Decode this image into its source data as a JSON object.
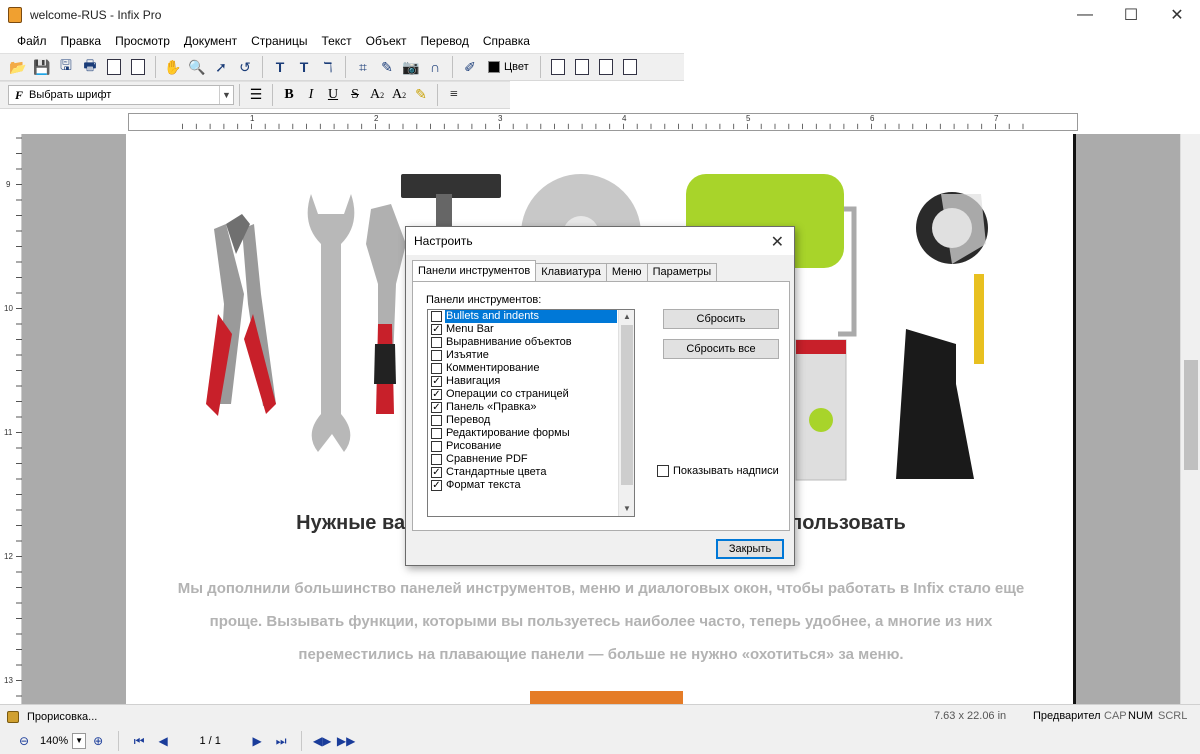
{
  "window": {
    "title": "welcome-RUS - Infix Pro",
    "minimize": "—",
    "maximize": "☐",
    "close": "✕"
  },
  "menu": [
    "Файл",
    "Правка",
    "Просмотр",
    "Документ",
    "Страницы",
    "Текст",
    "Объект",
    "Перевод",
    "Справка"
  ],
  "toolbar1": {
    "color_label": "Цвет"
  },
  "toolbar2": {
    "font_placeholder": "Выбрать шрифт"
  },
  "ruler": {
    "h_labels": [
      "1",
      "2",
      "3",
      "4",
      "5",
      "6",
      "7"
    ],
    "v_labels": [
      "9",
      "10",
      "11",
      "12",
      "13"
    ]
  },
  "page": {
    "heading": "Нужные вам инструменты стало легко найти и использовать",
    "paragraph": "Мы дополнили большинство панелей инструментов, меню и диалоговых окон, чтобы работать в Infix стало еще проще. Вызывать функции, которыми вы пользуетесь наиболее часто, теперь удобнее, а многие из них переместились на плавающие панели — больше не нужно «охотиться» за меню."
  },
  "dialog": {
    "title": "Настроить",
    "tabs": [
      "Панели инструментов",
      "Клавиатура",
      "Меню",
      "Параметры"
    ],
    "list_label": "Панели инструментов:",
    "items": [
      {
        "label": "Bullets and indents",
        "checked": false,
        "selected": true
      },
      {
        "label": "Menu Bar",
        "checked": true
      },
      {
        "label": "Выравнивание объектов",
        "checked": false
      },
      {
        "label": "Изъятие",
        "checked": false
      },
      {
        "label": "Комментирование",
        "checked": false
      },
      {
        "label": "Навигация",
        "checked": true
      },
      {
        "label": "Операции со страницей",
        "checked": true
      },
      {
        "label": "Панель «Правка»",
        "checked": true
      },
      {
        "label": "Перевод",
        "checked": false
      },
      {
        "label": "Редактирование формы",
        "checked": false
      },
      {
        "label": "Рисование",
        "checked": false
      },
      {
        "label": "Сравнение PDF",
        "checked": false
      },
      {
        "label": "Стандартные цвета",
        "checked": true
      },
      {
        "label": "Формат текста",
        "checked": true
      }
    ],
    "reset": "Сбросить",
    "reset_all": "Сбросить все",
    "show_labels": "Показывать надписи",
    "close": "Закрыть"
  },
  "status": {
    "message": "Прорисовка...",
    "coords": "7.63 x 22.06 in",
    "mode": "Предварител",
    "cap": "CAP",
    "num": "NUM",
    "scrl": "SCRL"
  },
  "nav": {
    "zoom": "140%",
    "page": "1 / 1"
  }
}
